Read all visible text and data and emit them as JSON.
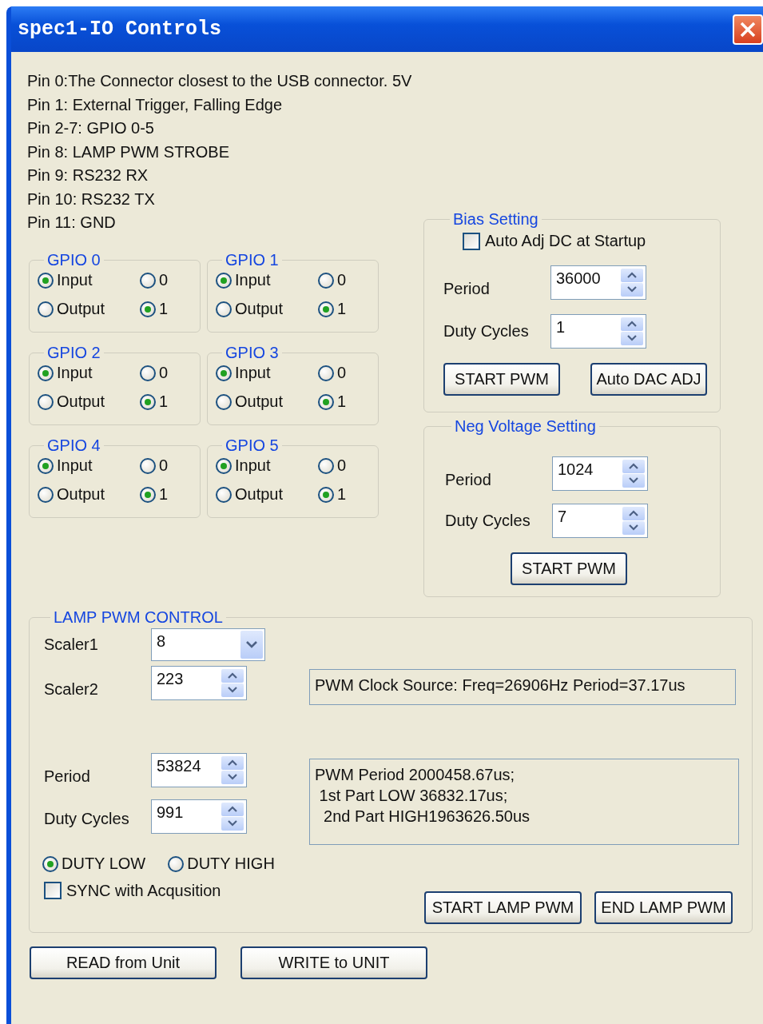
{
  "window": {
    "title": "spec1-IO Controls"
  },
  "pin_notes": [
    "Pin 0:The Connector closest to the USB connector. 5V",
    "Pin 1: External Trigger, Falling Edge",
    "Pin 2-7: GPIO 0-5",
    "Pin 8: LAMP PWM STROBE",
    "Pin 9: RS232 RX",
    "Pin 10: RS232 TX",
    "Pin 11: GND"
  ],
  "gpio_groups": [
    {
      "title": "GPIO 0",
      "direction": [
        {
          "label": "Input",
          "selected": true
        },
        {
          "label": "Output",
          "selected": false
        }
      ],
      "value": [
        {
          "label": "0",
          "selected": false
        },
        {
          "label": "1",
          "selected": true
        }
      ]
    },
    {
      "title": "GPIO 1",
      "direction": [
        {
          "label": "Input",
          "selected": true
        },
        {
          "label": "Output",
          "selected": false
        }
      ],
      "value": [
        {
          "label": "0",
          "selected": false
        },
        {
          "label": "1",
          "selected": true
        }
      ]
    },
    {
      "title": "GPIO 2",
      "direction": [
        {
          "label": "Input",
          "selected": true
        },
        {
          "label": "Output",
          "selected": false
        }
      ],
      "value": [
        {
          "label": "0",
          "selected": false
        },
        {
          "label": "1",
          "selected": true
        }
      ]
    },
    {
      "title": "GPIO 3",
      "direction": [
        {
          "label": "Input",
          "selected": true
        },
        {
          "label": "Output",
          "selected": false
        }
      ],
      "value": [
        {
          "label": "0",
          "selected": false
        },
        {
          "label": "1",
          "selected": true
        }
      ]
    },
    {
      "title": "GPIO 4",
      "direction": [
        {
          "label": "Input",
          "selected": true
        },
        {
          "label": "Output",
          "selected": false
        }
      ],
      "value": [
        {
          "label": "0",
          "selected": false
        },
        {
          "label": "1",
          "selected": true
        }
      ]
    },
    {
      "title": "GPIO 5",
      "direction": [
        {
          "label": "Input",
          "selected": true
        },
        {
          "label": "Output",
          "selected": false
        }
      ],
      "value": [
        {
          "label": "0",
          "selected": false
        },
        {
          "label": "1",
          "selected": true
        }
      ]
    }
  ],
  "bias_setting": {
    "title": "Bias Setting",
    "checkbox": {
      "label": "Auto Adj DC at Startup",
      "checked": false
    },
    "fields": [
      {
        "label": "Period",
        "value": "36000"
      },
      {
        "label": "Duty Cycles",
        "value": "1"
      }
    ],
    "buttons": [
      "START PWM",
      "Auto DAC ADJ"
    ]
  },
  "neg_voltage_setting": {
    "title": "Neg Voltage Setting",
    "fields": [
      {
        "label": "Period",
        "value": "1024"
      },
      {
        "label": "Duty Cycles",
        "value": "7"
      }
    ],
    "buttons": [
      "START PWM"
    ]
  },
  "lamp_pwm_control": {
    "title": "LAMP PWM CONTROL",
    "scaler1": {
      "label": "Scaler1",
      "value": "8"
    },
    "scaler2": {
      "label": "Scaler2",
      "value": "223"
    },
    "clock_info": "PWM Clock Source: Freq=26906Hz Period=37.17us",
    "period": {
      "label": "Period",
      "value": "53824"
    },
    "duty_cycles": {
      "label": "Duty Cycles",
      "value": "991"
    },
    "period_info": "PWM Period 2000458.67us;\n 1st Part LOW 36832.17us;\n  2nd Part HIGH1963626.50us",
    "duty_mode": [
      {
        "label": "DUTY LOW",
        "selected": true
      },
      {
        "label": "DUTY HIGH",
        "selected": false
      }
    ],
    "sync": {
      "label": "SYNC with Acqusition",
      "checked": false
    },
    "buttons": [
      "START LAMP PWM",
      "END LAMP PWM"
    ]
  },
  "footer_buttons": [
    "READ from Unit",
    "WRITE to UNIT"
  ]
}
